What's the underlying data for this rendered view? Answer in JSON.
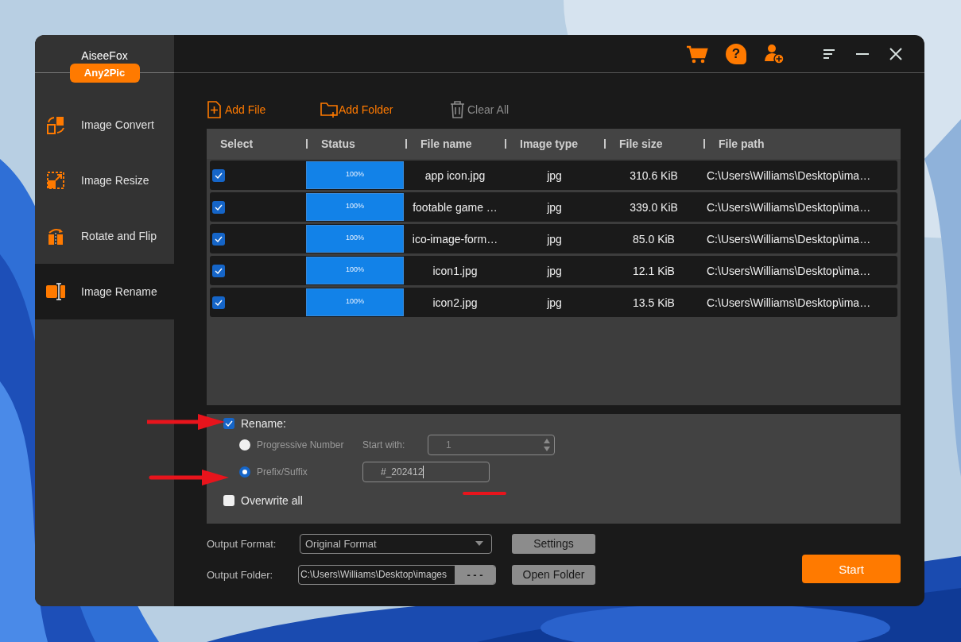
{
  "app": {
    "brand": "AiseeFox",
    "product": "Any2Pic",
    "help_glyph": "?"
  },
  "sidebar": {
    "items": [
      {
        "kind": "convert",
        "label": "Image Convert",
        "selected": false
      },
      {
        "kind": "resize",
        "label": "Image Resize",
        "selected": false
      },
      {
        "kind": "rotate",
        "label": "Rotate and Flip",
        "selected": false
      },
      {
        "kind": "rename",
        "label": "Image Rename",
        "selected": true
      }
    ]
  },
  "toolbar": [
    {
      "kind": "file",
      "label": "Add File",
      "disabled": false
    },
    {
      "kind": "folder",
      "label": "Add Folder",
      "disabled": false
    },
    {
      "kind": "trash",
      "label": "Clear All",
      "disabled": true
    }
  ],
  "table": {
    "columns": [
      "Select",
      "Status",
      "File name",
      "Image type",
      "File size",
      "File path"
    ],
    "rows": [
      {
        "checked": true,
        "status": "100%",
        "level": 1,
        "name": "app icon.jpg",
        "type": "jpg",
        "size": "310.6 KiB",
        "path": "C:\\Users\\Williams\\Desktop\\ima…"
      },
      {
        "checked": true,
        "status": "100%",
        "level": 1,
        "name": "footable game …",
        "type": "jpg",
        "size": "339.0 KiB",
        "path": "C:\\Users\\Williams\\Desktop\\ima…"
      },
      {
        "checked": true,
        "status": "100%",
        "level": 1,
        "name": "ico-image-form…",
        "type": "jpg",
        "size": "85.0 KiB",
        "path": "C:\\Users\\Williams\\Desktop\\ima…"
      },
      {
        "checked": true,
        "status": "100%",
        "level": 1,
        "name": "icon1.jpg",
        "type": "jpg",
        "size": "12.1 KiB",
        "path": "C:\\Users\\Williams\\Desktop\\ima…"
      },
      {
        "checked": true,
        "status": "100%",
        "level": 1,
        "name": "icon2.jpg",
        "type": "jpg",
        "size": "13.5 KiB",
        "path": "C:\\Users\\Williams\\Desktop\\ima…"
      }
    ]
  },
  "rename": {
    "label": "Rename:",
    "checked": true,
    "options": [
      {
        "label": "Progressive Number",
        "selected": false
      },
      {
        "label": "Prefix/Suffix",
        "selected": true
      }
    ],
    "start_label": "Start with:",
    "start_value": "1",
    "affix_value": "#_202412",
    "overwrite": {
      "label": "Overwrite all",
      "checked": false
    }
  },
  "output": {
    "format_label": "Output Format:",
    "format_value": "Original Format",
    "settings": "Settings",
    "folder_label": "Output Folder:",
    "folder_value": "C:\\Users\\Williams\\Desktop\\images",
    "browse": "- - -",
    "open_folder": "Open Folder",
    "start": "Start"
  }
}
